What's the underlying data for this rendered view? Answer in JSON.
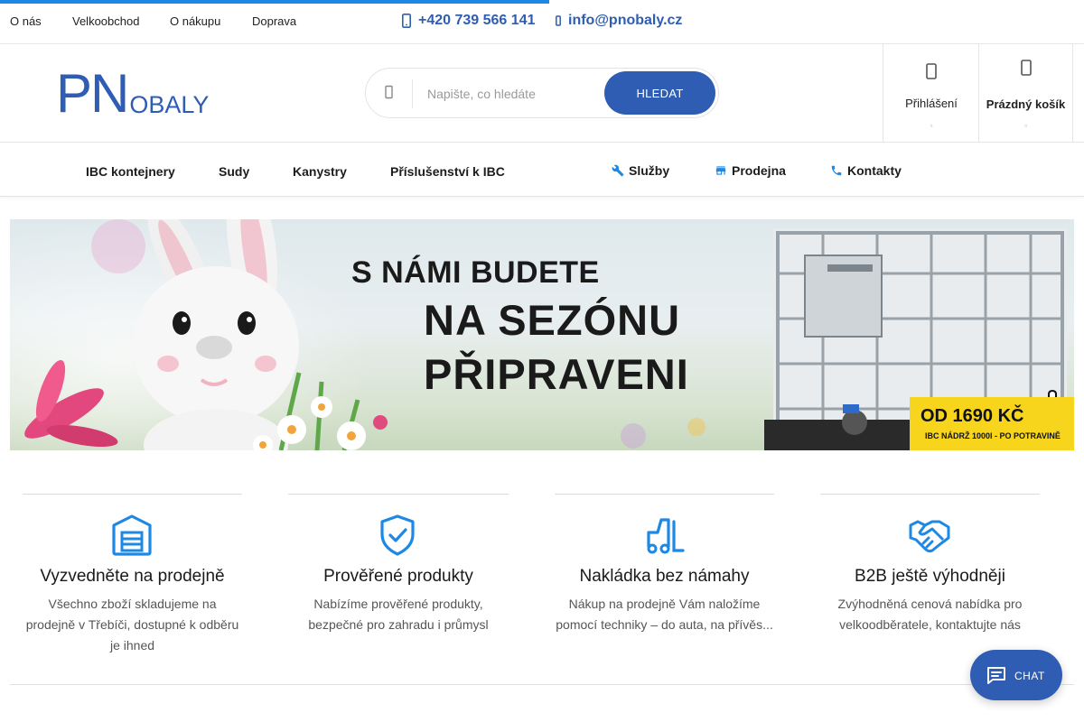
{
  "top_links": [
    "O nás",
    "Velkoobchod",
    "O nákupu",
    "Doprava"
  ],
  "contacts": {
    "phone": "+420 739 566 141",
    "email": "info@pnobaly.cz"
  },
  "logo": {
    "big": "PN",
    "small": "OBALY"
  },
  "search": {
    "placeholder": "Napište, co hledáte",
    "button": "HLEDAT"
  },
  "account": {
    "login": "Přihlášení",
    "cart": "Prázdný košík"
  },
  "nav": {
    "categories": [
      "IBC kontejnery",
      "Sudy",
      "Kanystry",
      "Příslušenství k IBC"
    ],
    "services": [
      {
        "label": "Služby",
        "icon": "wrench-icon"
      },
      {
        "label": "Prodejna",
        "icon": "store-icon"
      },
      {
        "label": "Kontakty",
        "icon": "phone-icon"
      }
    ]
  },
  "banner": {
    "line1": "S NÁMI BUDETE",
    "line2": "NA SEZÓNU",
    "line3": "PŘIPRAVENI",
    "price": "OD 1690 KČ",
    "price_note": "IBC NÁDRŽ 1000l - PO POTRAVINĚ"
  },
  "features": [
    {
      "title": "Vyzvedněte na prodejně",
      "desc": "Všechno zboží skladujeme na prodejně v Třebíči, dostupné k odběru je ihned",
      "icon": "warehouse-icon"
    },
    {
      "title": "Prověřené produkty",
      "desc": "Nabízíme prověřené produkty, bezpečné pro zahradu i průmysl",
      "icon": "shield-check-icon"
    },
    {
      "title": "Nakládka bez námahy",
      "desc": "Nákup na prodejně Vám naložíme pomocí techniky – do auta, na přívěs...",
      "icon": "forklift-icon"
    },
    {
      "title": "B2B ještě výhodněji",
      "desc": "Zvýhodněná cenová nabídka pro velkoodběratele, kontaktujte nás",
      "icon": "handshake-icon"
    }
  ],
  "chat": {
    "label": "CHAT"
  },
  "colors": {
    "brand": "#2f5db3",
    "accent": "#1e88e5",
    "price_badge": "#f6d51c"
  }
}
